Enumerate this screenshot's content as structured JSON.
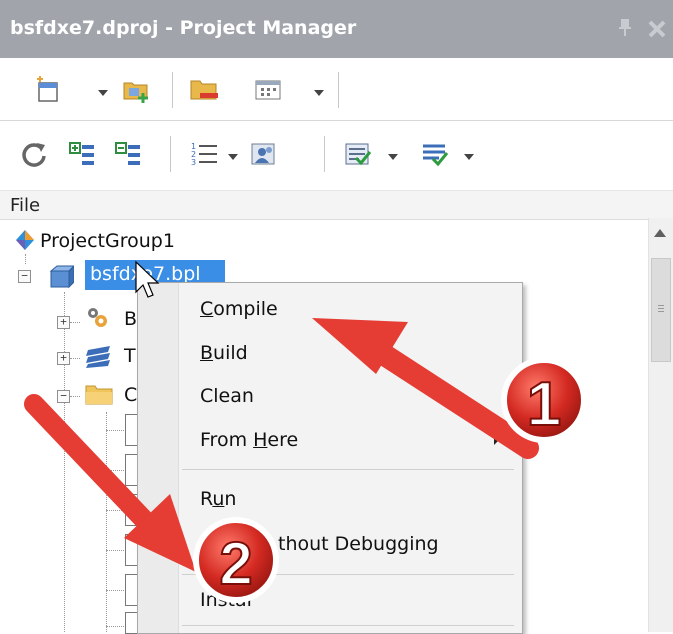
{
  "window": {
    "title": "bsfdxe7.dproj - Project Manager",
    "titlebar_color": "#a1a4ab"
  },
  "toolbar1": {
    "icons": [
      "new-project-icon",
      "add-new-project-icon",
      "remove-project-icon",
      "view-icon"
    ]
  },
  "toolbar2": {
    "icons": [
      "sync-icon",
      "expand-icon",
      "collapse-icon",
      "list-icon",
      "build-config-icon",
      "compile-all-icon",
      "build-all-icon"
    ]
  },
  "tree": {
    "header": "File",
    "root_label": "ProjectGroup1",
    "selected_label": "bsfdxe7.bpl",
    "children_partial": [
      "B",
      "T",
      "C"
    ]
  },
  "context_menu": {
    "items": [
      {
        "prefix": "",
        "underline": "C",
        "suffix": "ompile"
      },
      {
        "prefix": "",
        "underline": "B",
        "suffix": "uild"
      },
      {
        "prefix": "Clean",
        "underline": "",
        "suffix": ""
      },
      {
        "prefix": "From ",
        "underline": "H",
        "suffix": "ere"
      },
      {
        "prefix": "R",
        "underline": "u",
        "suffix": "n"
      },
      {
        "prefix": "thout Debugging",
        "underline": "",
        "suffix": ""
      },
      {
        "prefix": "",
        "underline": "",
        "suffix": "Instal"
      }
    ]
  },
  "annotations": {
    "arrow_color": "#e53c33",
    "badge_color": "#d42a22",
    "badges": [
      "1",
      "2"
    ]
  },
  "colors": {
    "selection": "#3b8ee6"
  }
}
